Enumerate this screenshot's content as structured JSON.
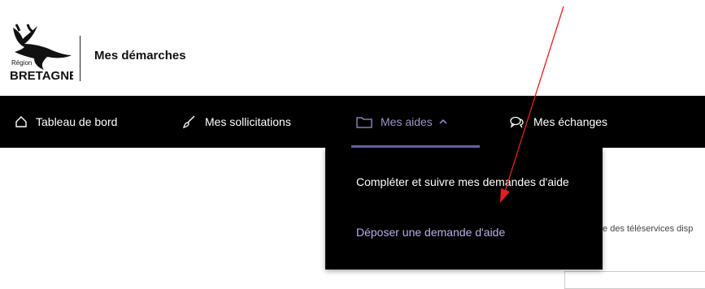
{
  "header": {
    "logo_region": "Région",
    "logo_name": "BRETAGNE",
    "site_title": "Mes démarches"
  },
  "nav": {
    "items": [
      {
        "label": "Tableau de bord",
        "icon": "home-icon"
      },
      {
        "label": "Mes sollicitations",
        "icon": "brush-icon"
      },
      {
        "label": "Mes aides",
        "icon": "folder-icon",
        "active": true,
        "expanded": true
      },
      {
        "label": "Mes échanges",
        "icon": "chat-icon"
      }
    ]
  },
  "dropdown": {
    "items": [
      {
        "label": "Compléter et suivre mes demandes d'aide"
      },
      {
        "label": "Déposer une demande d'aide",
        "highlighted": true
      }
    ]
  },
  "background": {
    "partial_text": "te des téléservices disp"
  },
  "colors": {
    "nav_bg": "#000000",
    "active_accent": "#9a95c9",
    "annotation_arrow": "#e02020"
  }
}
